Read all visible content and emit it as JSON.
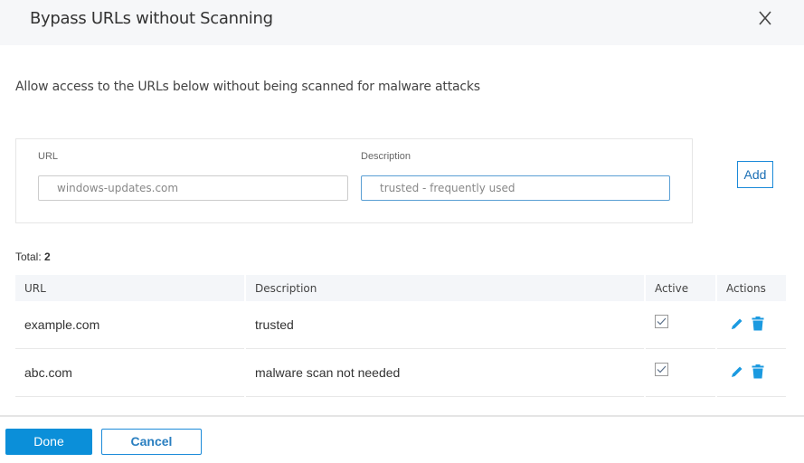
{
  "dialog": {
    "title": "Bypass URLs without Scanning",
    "close_icon": "close-icon",
    "subtitle": "Allow access to the URLs below without being scanned for malware attacks"
  },
  "form": {
    "url_label": "URL",
    "url_value": "windows-updates.com",
    "description_label": "Description",
    "description_value": "trusted - frequently used",
    "add_label": "Add"
  },
  "table": {
    "total_label": "Total:",
    "total_count": "2",
    "headers": [
      "URL",
      "Description",
      "Active",
      "Actions"
    ],
    "rows": [
      {
        "url": "example.com",
        "description": "trusted",
        "active": true
      },
      {
        "url": "abc.com",
        "description": "malware scan not needed",
        "active": true
      }
    ],
    "action_icons": [
      "pencil-icon",
      "trash-icon"
    ]
  },
  "footer": {
    "done_label": "Done",
    "cancel_label": "Cancel"
  },
  "colors": {
    "accent": "#0b8fd9",
    "icon_blue": "#1b9ae0",
    "header_bg": "#f6f7f9"
  }
}
